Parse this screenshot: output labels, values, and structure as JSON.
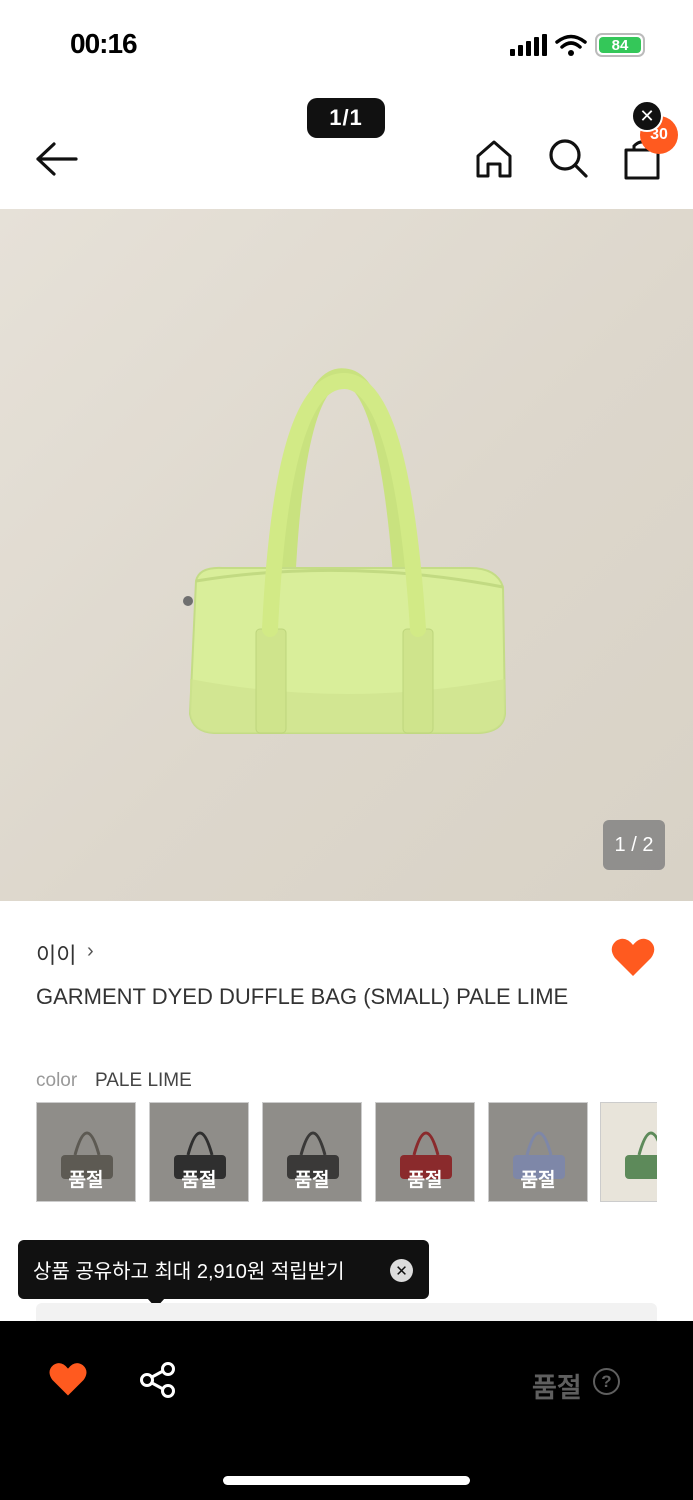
{
  "status_bar": {
    "time": "00:16",
    "battery": "84"
  },
  "viewer": {
    "page_indicator": "1/1",
    "close_label": "✕"
  },
  "header": {
    "cart_count": "30"
  },
  "product": {
    "image_counter": "1 / 2",
    "brand": "이이",
    "brand_chevron": "›",
    "title": "GARMENT DYED DUFFLE BAG (SMALL) PALE LIME",
    "color_label": "color",
    "color_value": "PALE LIME",
    "bag_color": "#d9ee9a",
    "swatches": [
      {
        "label": "품절",
        "bag_color": "#5d5a53"
      },
      {
        "label": "품절",
        "bag_color": "#2f2f2f"
      },
      {
        "label": "품절",
        "bag_color": "#3a3938"
      },
      {
        "label": "품절",
        "bag_color": "#8a2a2c"
      },
      {
        "label": "품절",
        "bag_color": "#7e87a8"
      },
      {
        "label": "",
        "bag_color": "#5d8a5a"
      }
    ]
  },
  "tooltip": {
    "text": "상품 공유하고 최대 2,910원 적립받기",
    "close_label": "✕"
  },
  "bottom_bar": {
    "status_label": "품절",
    "help_label": "?"
  },
  "colors": {
    "accent": "#ff5a1f",
    "bar_bg": "#000000",
    "soldout_text": "#5f5f5f"
  }
}
